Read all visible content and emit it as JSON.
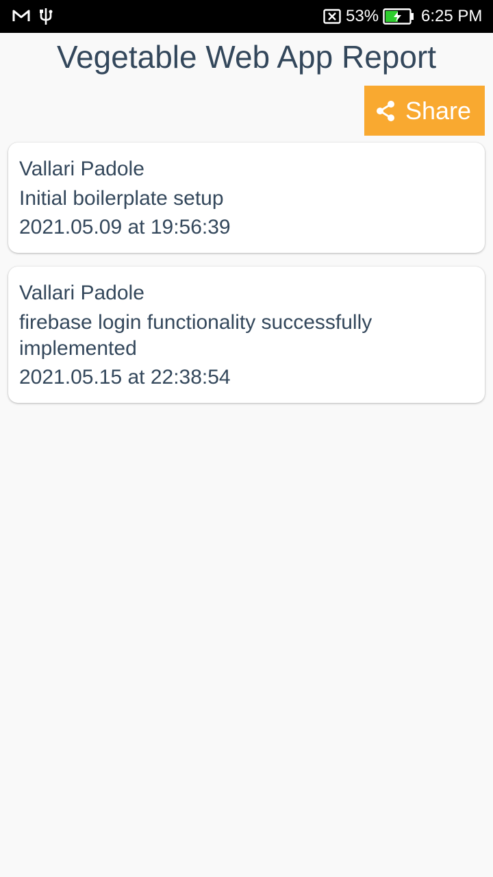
{
  "status_bar": {
    "icons_left": [
      "gmail-icon",
      "usb-icon"
    ],
    "icons_right": [
      "no-sim-icon",
      "battery-charging-icon"
    ],
    "battery_percent": "53%",
    "battery_level": 0.53,
    "time": "6:25 PM",
    "battery_color": "#2ecc2e"
  },
  "page": {
    "title": "Vegetable Web App Report"
  },
  "toolbar": {
    "share_label": "Share",
    "share_icon": "share-icon",
    "share_color": "#f9a930"
  },
  "commits": [
    {
      "author": "Vallari Padole",
      "message": "Initial boilerplate setup",
      "timestamp": "2021.05.09 at 19:56:39"
    },
    {
      "author": "Vallari Padole",
      "message": "firebase login functionality successfully implemented",
      "timestamp": "2021.05.15 at 22:38:54"
    }
  ]
}
